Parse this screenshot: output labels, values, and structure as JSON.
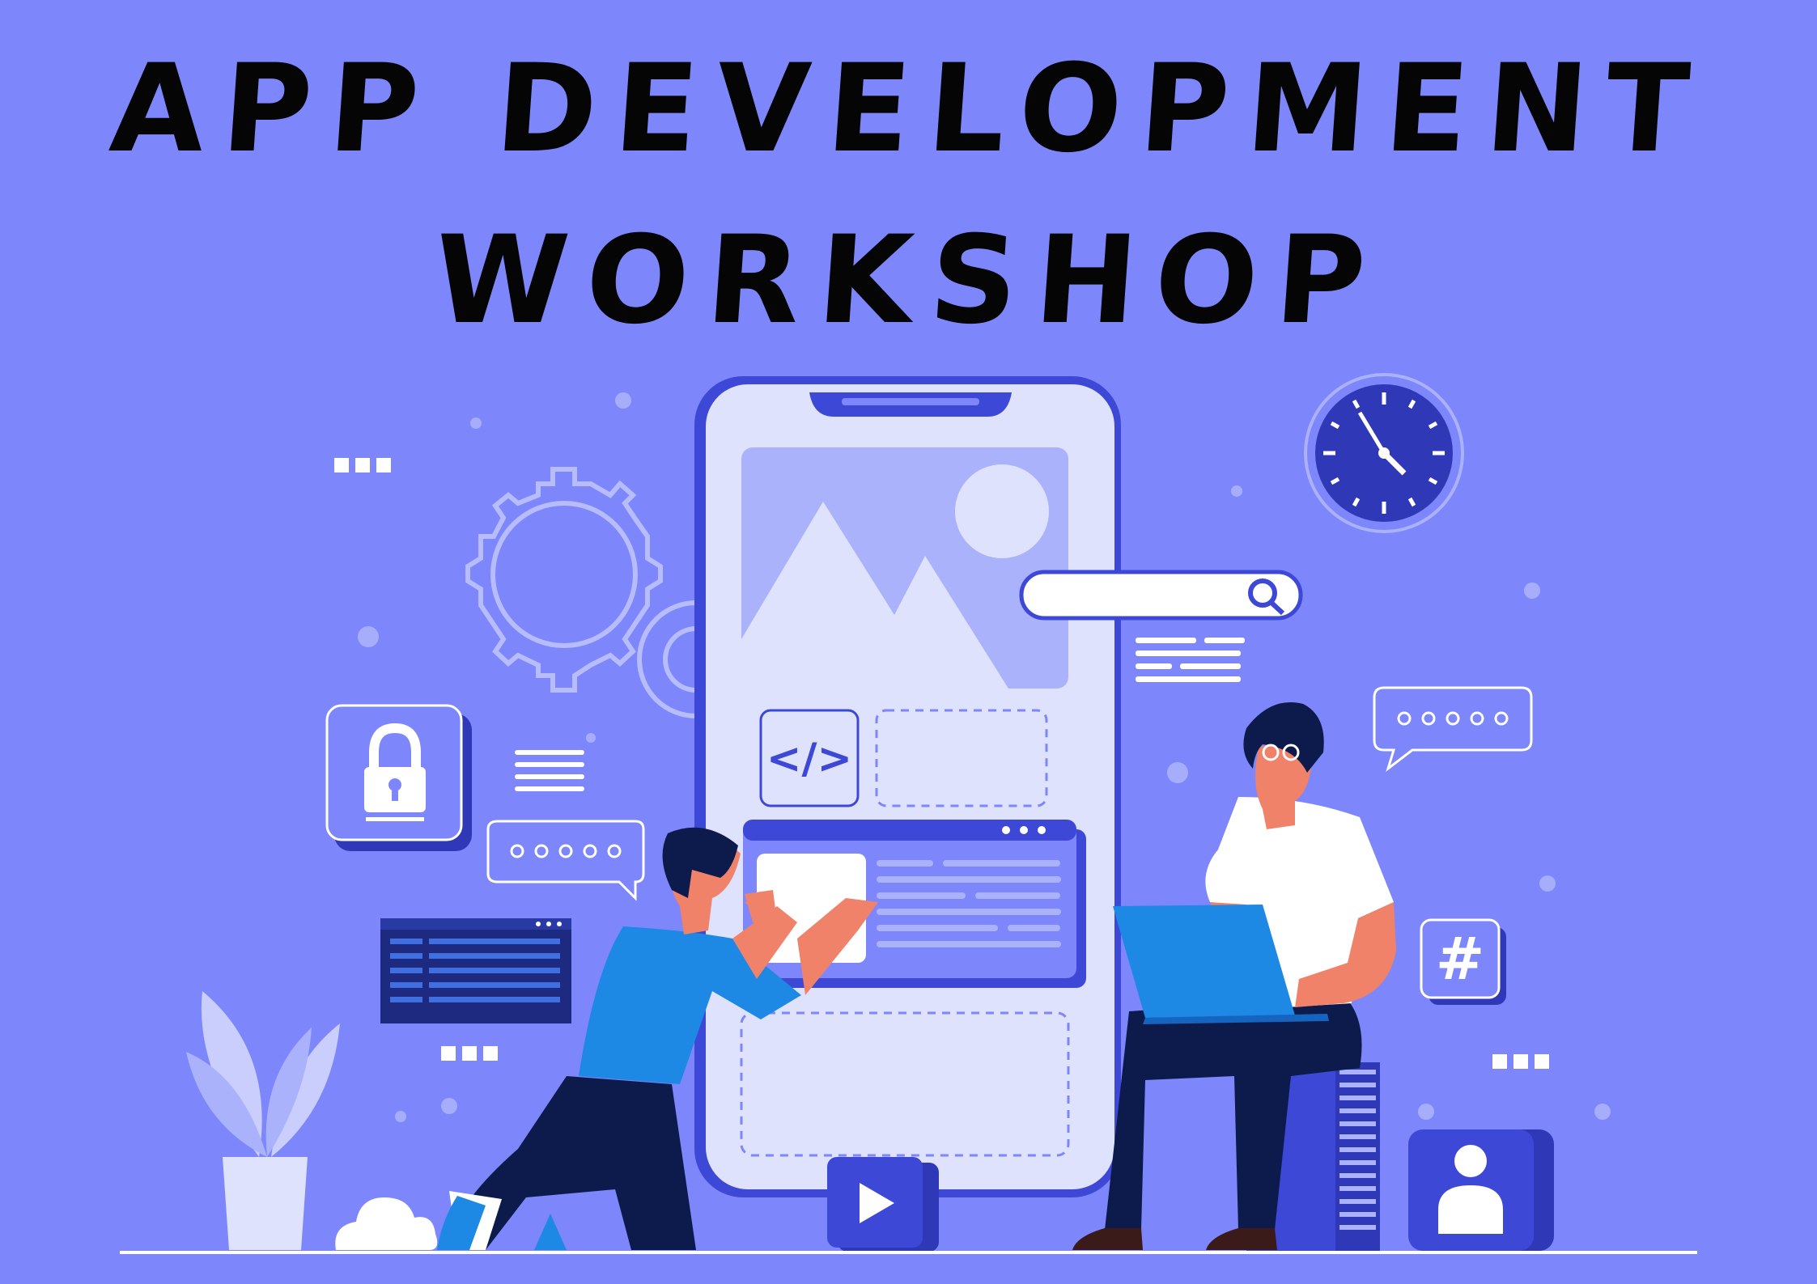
{
  "poster": {
    "title_line_1": "APP DEVELOPMENT",
    "title_line_2": "WORKSHOP",
    "code_symbol": "</>",
    "hash_symbol": "#"
  },
  "colors": {
    "background": "#7d87fb",
    "title": "#050505",
    "phone_frame": "#3d49d6",
    "phone_screen": "#dfe2fd",
    "dark_navy": "#1d2a80",
    "accent_blue": "#1e88e5",
    "white": "#ffffff"
  },
  "icons": [
    "gear-icon",
    "lock-icon",
    "clock-icon",
    "search-icon",
    "code-icon",
    "play-icon",
    "user-icon",
    "hash-icon",
    "chat-bubble-icon",
    "plant-icon",
    "cloud-icon"
  ]
}
